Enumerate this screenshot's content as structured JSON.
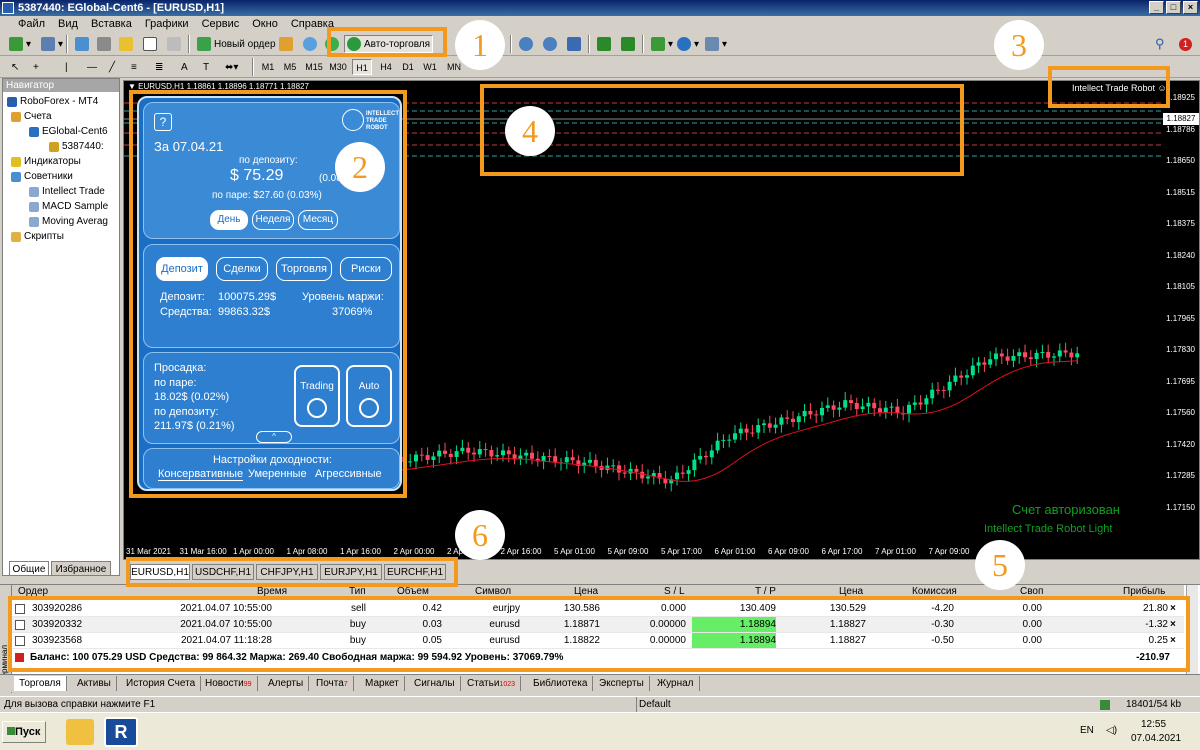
{
  "window": {
    "title": "5387440: EGlobal-Cent6 - [EURUSD,H1]"
  },
  "menu": [
    "Файл",
    "Вид",
    "Вставка",
    "Графики",
    "Сервис",
    "Окно",
    "Справка"
  ],
  "toolbar": {
    "new_order": "Новый ордер",
    "autotrading": "Авто-торговля",
    "timeframes": [
      "M1",
      "M5",
      "M15",
      "M30",
      "H1",
      "H4",
      "D1",
      "W1",
      "MN"
    ],
    "active_tf": "H1",
    "notify_count": "1"
  },
  "navigator": {
    "title": "Навигатор",
    "root": "RoboForex - MT4",
    "accounts": "Счета",
    "server": "EGlobal-Cent6",
    "account": "5387440:",
    "indicators": "Индикаторы",
    "advisors": "Советники",
    "ea_items": [
      "Intellect Trade",
      "MACD Sample",
      "Moving Averag"
    ],
    "scripts": "Скрипты",
    "tabs": [
      "Общие",
      "Избранное"
    ]
  },
  "chart": {
    "header": "▼ EURUSD,H1  1.18861 1.18896 1.18771 1.18827",
    "ea_label": "Intellect Trade Robot ☺",
    "auth_text": "Счет авторизован",
    "robot_text": "Intellect Trade Robot Light",
    "current_price": "1.18827",
    "price_labels": [
      "1.18925",
      "1.18786",
      "1.18650",
      "1.18515",
      "1.18375",
      "1.18240",
      "1.18105",
      "1.17965",
      "1.17830",
      "1.17695",
      "1.17560",
      "1.17420",
      "1.17285",
      "1.17150"
    ],
    "time_labels": [
      "31 Mar 2021",
      "31 Mar 16:00",
      "1 Apr 00:00",
      "1 Apr 08:00",
      "1 Apr 16:00",
      "2 Apr 00:00",
      "2 Apr 08:00",
      "2 Apr 16:00",
      "5 Apr 01:00",
      "5 Apr 09:00",
      "5 Apr 17:00",
      "6 Apr 01:00",
      "6 Apr 09:00",
      "6 Apr 17:00",
      "7 Apr 01:00",
      "7 Apr 09:00"
    ]
  },
  "panel": {
    "help": "?",
    "logo": "INTELLECT TRADE ROBOT",
    "date": "За 07.04.21",
    "deposit_label": "по депозиту:",
    "deposit_profit": "$ 75.29",
    "deposit_pct": "(0.08%)",
    "pair_profit": "по паре: $27.60 (0.03%)",
    "period_tabs": [
      "День",
      "Неделя",
      "Месяц"
    ],
    "info_tabs": [
      "Депозит",
      "Сделки",
      "Торговля",
      "Риски"
    ],
    "deposit_line": "Депозит:",
    "deposit_value": "100075.29$",
    "equity_line": "Средства:",
    "equity_value": "99863.32$",
    "margin_label": "Уровень маржи:",
    "margin_value": "37069%",
    "drawdown_title": "Просадка:",
    "dd_pair_label": "по паре:",
    "dd_pair": "18.02$ (0.02%)",
    "dd_dep_label": "по депозиту:",
    "dd_dep": "211.97$ (0.21%)",
    "trading_btn": "Trading",
    "auto_btn": "Auto",
    "profit_title": "Настройки доходности:",
    "profit_modes": [
      "Консервативные",
      "Умеренные",
      "Агрессивные"
    ]
  },
  "chart_tabs": [
    "EURUSD,H1",
    "USDCHF,H1",
    "CHFJPY,H1",
    "EURJPY,H1",
    "EURCHF,H1"
  ],
  "terminal": {
    "side_label": "Терминал",
    "headers": [
      "Ордер",
      "Время",
      "Тип",
      "Объем",
      "Символ",
      "Цена",
      "S / L",
      "T / P",
      "Цена",
      "Комиссия",
      "Своп",
      "Прибыль"
    ],
    "rows": [
      {
        "order": "303920286",
        "time": "2021.04.07 10:55:00",
        "type": "sell",
        "volume": "0.42",
        "symbol": "eurjpy",
        "price": "130.586",
        "sl": "0.000",
        "tp": "130.409",
        "cur": "130.529",
        "commission": "-4.20",
        "swap": "0.00",
        "profit": "21.80"
      },
      {
        "order": "303920332",
        "time": "2021.04.07 10:55:00",
        "type": "buy",
        "volume": "0.03",
        "symbol": "eurusd",
        "price": "1.18871",
        "sl": "0.00000",
        "tp": "1.18894",
        "cur": "1.18827",
        "commission": "-0.30",
        "swap": "0.00",
        "profit": "-1.32"
      },
      {
        "order": "303923568",
        "time": "2021.04.07 11:18:28",
        "type": "buy",
        "volume": "0.05",
        "symbol": "eurusd",
        "price": "1.18822",
        "sl": "0.00000",
        "tp": "1.18894",
        "cur": "1.18827",
        "commission": "-0.50",
        "swap": "0.00",
        "profit": "0.25"
      }
    ],
    "summary": "Баланс: 100 075.29 USD  Средства: 99 864.32  Маржа: 269.40  Свободная маржа: 99 594.92  Уровень: 37069.79%",
    "total": "-210.97",
    "tabs": [
      "Торговля",
      "Активы",
      "История Счета",
      "Новости",
      "Алерты",
      "Почта",
      "Маркет",
      "Сигналы",
      "Статьи",
      "Библиотека",
      "Эксперты",
      "Журнал"
    ],
    "news_badge": "99",
    "mail_badge": "7",
    "articles_badge": "1023"
  },
  "status": {
    "help": "Для вызова справки нажмите F1",
    "profile": "Default",
    "traffic": "18401/54 kb"
  },
  "taskbar": {
    "start": "Пуск",
    "lang": "EN",
    "time": "12:55",
    "date": "07.04.2021"
  },
  "annotations": [
    "1",
    "2",
    "3",
    "4",
    "5",
    "6"
  ],
  "colors": {
    "accent": "#f39a1e",
    "bull": "#00e08a",
    "bear": "#ff4a5e",
    "ma": "#e01020",
    "tp_hit": "#66ee66"
  }
}
